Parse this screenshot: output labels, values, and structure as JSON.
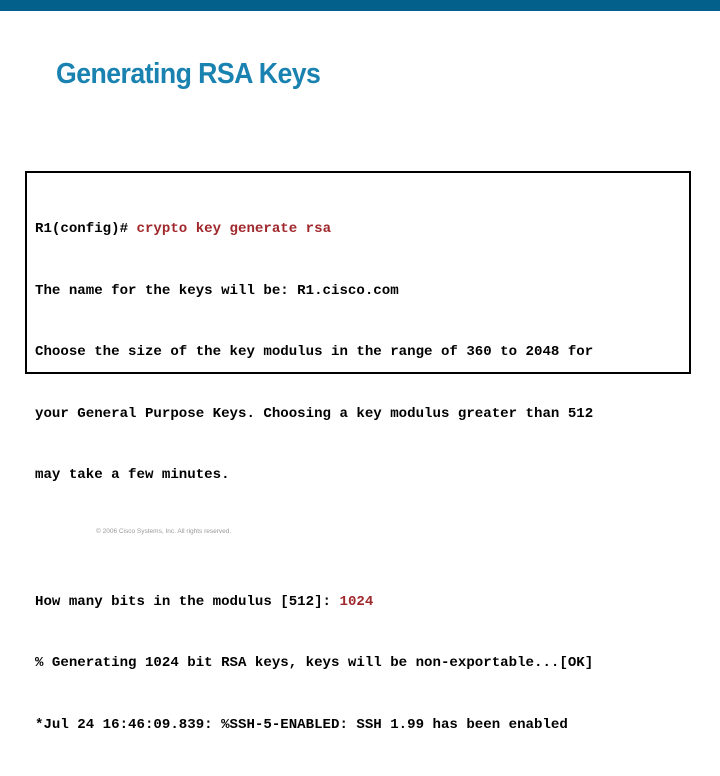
{
  "header": {
    "bar_color": "#03608a"
  },
  "slide": {
    "title": "Generating RSA Keys",
    "title_color": "#1a82b0"
  },
  "terminal": {
    "command_color": "#a0282c",
    "lines": [
      {
        "prefix": "R1(config)# ",
        "command": "crypto key generate rsa"
      },
      {
        "text": "The name for the keys will be: R1.cisco.com"
      },
      {
        "text": "Choose the size of the key modulus in the range of 360 to 2048 for"
      },
      {
        "text": "your General Purpose Keys. Choosing a key modulus greater than 512"
      },
      {
        "text": "may take a few minutes."
      },
      {
        "text": ""
      },
      {
        "prefix": "How many bits in the modulus [512]: ",
        "command": "1024"
      },
      {
        "text": "% Generating 1024 bit RSA keys, keys will be non-exportable...[OK]"
      },
      {
        "text": "*Jul 24 16:46:09.839: %SSH-5-ENABLED: SSH 1.99 has been enabled"
      }
    ]
  },
  "footer": {
    "copyright": "© 2006 Cisco Systems, Inc. All rights reserved."
  }
}
